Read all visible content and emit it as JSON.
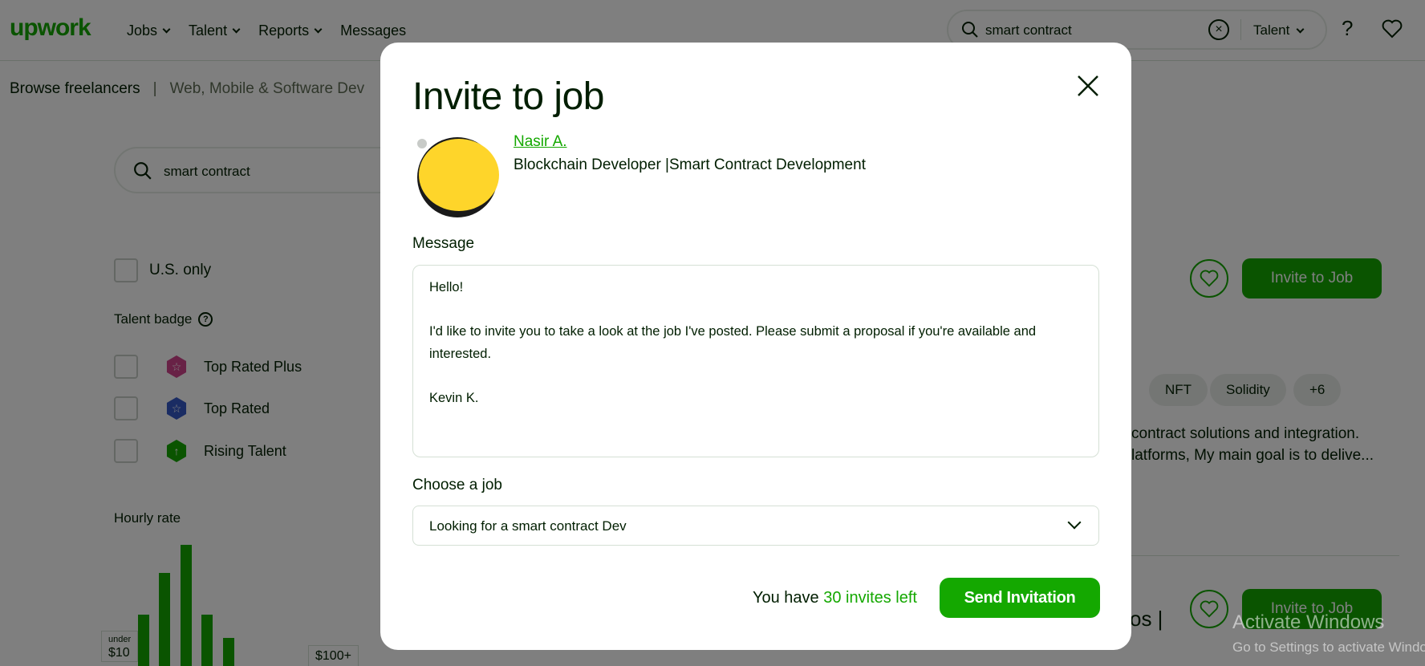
{
  "nav": {
    "logo": "upwork",
    "links": [
      "Jobs",
      "Talent",
      "Reports",
      "Messages"
    ],
    "search_value": "smart contract",
    "search_scope": "Talent"
  },
  "breadcrumb": {
    "root": "Browse freelancers",
    "separator": "|",
    "category": "Web, Mobile & Software Dev"
  },
  "filters": {
    "search_value": "smart contract",
    "us_only": "U.S. only",
    "talent_badge_heading": "Talent badge",
    "badges": [
      "Top Rated Plus",
      "Top Rated",
      "Rising Talent"
    ],
    "hourly_rate_heading": "Hourly rate",
    "rate_min_small": "under",
    "rate_min": "$10",
    "rate_max": "$100+"
  },
  "results": {
    "invite_label": "Invite to Job",
    "skills": [
      "NFT",
      "Solidity",
      "+6"
    ],
    "desc_line1": "contract solutions and integration.",
    "desc_line2": "latforms, My main goal is to delive...",
    "title_fragment": "os |"
  },
  "watermark": {
    "title": "Activate Windows",
    "sub": "Go to Settings to activate Windows."
  },
  "modal": {
    "title": "Invite to job",
    "freelancer_name": "Nasir A.",
    "freelancer_title": "Blockchain Developer |Smart Contract Development",
    "message_label": "Message",
    "message_lines": [
      "Hello!",
      "I'd like to invite you to take a look at the job I've posted. Please submit a proposal if you're available and interested.",
      "Kevin K."
    ],
    "choose_job_label": "Choose a job",
    "selected_job": "Looking for a smart contract Dev",
    "invites_prefix": "You have",
    "invites_count": "30 invites left",
    "send_label": "Send Invitation"
  },
  "colors": {
    "brand": "#14a800",
    "avatar_yellow": "#fed52a"
  }
}
